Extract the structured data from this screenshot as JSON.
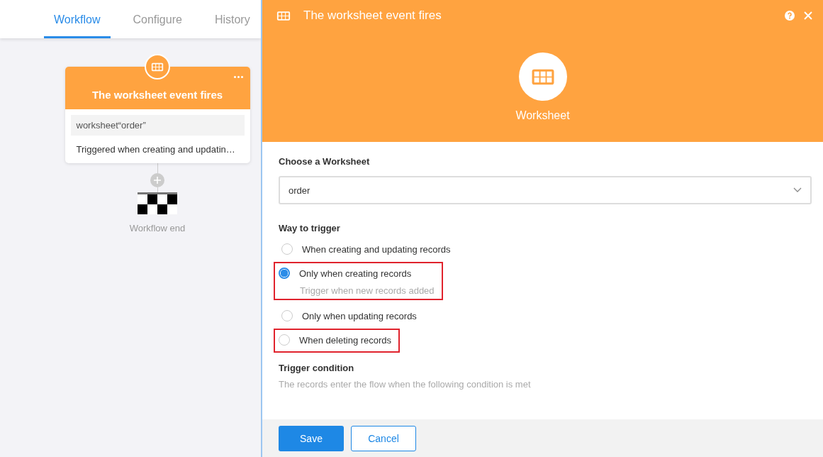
{
  "tabs": [
    {
      "label": "Workflow",
      "selected": true
    },
    {
      "label": "Configure",
      "selected": false
    },
    {
      "label": "History",
      "selected": false
    }
  ],
  "node": {
    "title": "The worksheet event fires",
    "source": "worksheet“order”",
    "description": "Triggered when creating and updatin…"
  },
  "end_label": "Workflow end",
  "panel": {
    "title": "The worksheet event fires",
    "hero_label": "Worksheet",
    "worksheet_label": "Choose a Worksheet",
    "worksheet_value": "order",
    "trigger_label": "Way to trigger",
    "options": [
      {
        "label": "When creating and updating records",
        "selected": false,
        "highlighted": false
      },
      {
        "label": "Only when creating records",
        "hint": "Trigger when new records added",
        "selected": true,
        "highlighted": true
      },
      {
        "label": "Only when updating records",
        "selected": false,
        "highlighted": false
      },
      {
        "label": "When deleting records",
        "selected": false,
        "highlighted": true
      }
    ],
    "condition_label": "Trigger condition",
    "condition_text": "The records enter the flow when the following condition is met",
    "buttons": [
      {
        "label": "Save",
        "kind": "primary"
      },
      {
        "label": "Cancel",
        "kind": "secondary"
      }
    ]
  }
}
